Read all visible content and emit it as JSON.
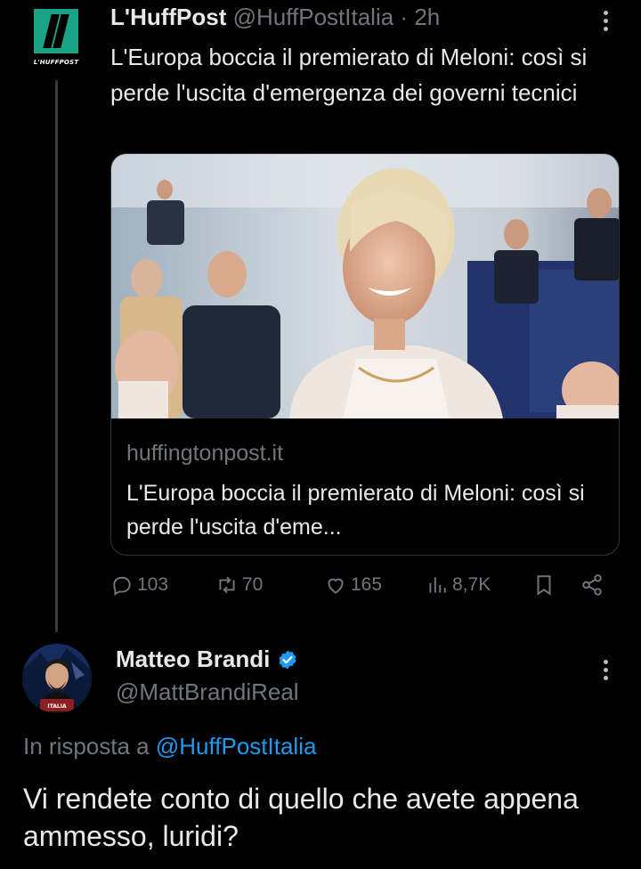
{
  "tweet1": {
    "avatar_logo_text": "L'HUFFPOST",
    "display_name": "L'HuffPost",
    "handle": "@HuffPostItalia",
    "separator": "·",
    "time": "2h",
    "text": "L'Europa boccia il premierato di Meloni: così si perde l'uscita d'emergenza dei governi tecnici",
    "card": {
      "domain": "huffingtonpost.it",
      "title": "L'Europa boccia il premierato di Meloni: così si perde l'uscita d'eme..."
    },
    "actions": {
      "replies": "103",
      "retweets": "70",
      "likes": "165",
      "views": "8,7K"
    }
  },
  "tweet2": {
    "avatar_badge_text": "ITALIA",
    "display_name": "Matteo Brandi",
    "handle": "@MattBrandiReal",
    "reply_prefix": "In risposta a",
    "reply_to": "@HuffPostItalia",
    "text": "Vi rendete conto di quello che avete appena ammesso, luridi?"
  },
  "colors": {
    "background": "#000000",
    "text": "#e7e9ea",
    "secondary": "#71767b",
    "link": "#1d9bf0",
    "huffpost_green": "#1aa384",
    "verified": "#1d9bf0"
  }
}
